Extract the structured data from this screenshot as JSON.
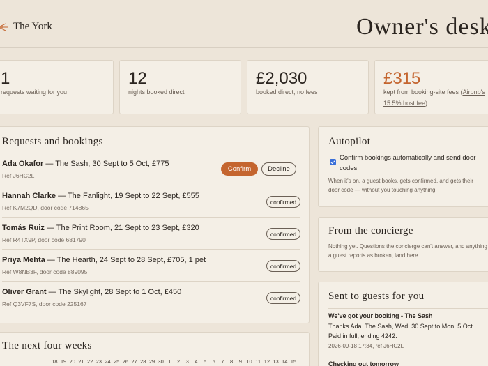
{
  "header": {
    "brand": "The York",
    "title": "Owner's desk"
  },
  "stats": [
    {
      "value": "1",
      "label": "requests waiting for you"
    },
    {
      "value": "12",
      "label": "nights booked direct"
    },
    {
      "value": "£2,030",
      "label": "booked direct, no fees"
    },
    {
      "value": "£315",
      "label_prefix": "kept from booking-site fees (",
      "label_link": "Airbnb's 15.5% host fee",
      "label_suffix": ")"
    }
  ],
  "bookings": {
    "title": "Requests and bookings",
    "confirm_label": "Confirm",
    "decline_label": "Decline",
    "rows": [
      {
        "guest": "Ada Okafor",
        "details": " — The Sash, 30 Sept to 5 Oct, £775",
        "ref": "Ref J6HC2L",
        "status": ""
      },
      {
        "guest": "Hannah Clarke",
        "details": " — The Fanlight, 19 Sept to 22 Sept, £555",
        "ref": "Ref K7M2QD, door code 714865",
        "status": "confirmed"
      },
      {
        "guest": "Tomás Ruiz",
        "details": " — The Print Room, 21 Sept to 23 Sept, £320",
        "ref": "Ref R4TX9P, door code 681790",
        "status": "confirmed"
      },
      {
        "guest": "Priya Mehta",
        "details": " — The Hearth, 24 Sept to 28 Sept, £705, 1 pet",
        "ref": "Ref W8NB3F, door code 889095",
        "status": "confirmed"
      },
      {
        "guest": "Oliver Grant",
        "details": " — The Skylight, 28 Sept to 1 Oct, £450",
        "ref": "Ref Q3VF7S, door code 225167",
        "status": "confirmed"
      }
    ]
  },
  "autopilot": {
    "title": "Autopilot",
    "checkbox_label": "Confirm bookings automatically and send door codes",
    "description": "When it's on, a guest books, gets confirmed, and gets their door code — without you touching anything."
  },
  "concierge": {
    "title": "From the concierge",
    "description": "Nothing yet. Questions the concierge can't answer, and anything a guest reports as broken, land here."
  },
  "sent": {
    "title": "Sent to guests for you",
    "messages": [
      {
        "subject": "We've got your booking - The Sash",
        "body": "Thanks Ada. The Sash, Wed, 30 Sept to Mon, 5 Oct. Paid in full, ending 4242.",
        "meta": "2026-09-18 17:34, ref J6HC2L"
      },
      {
        "subject": "Checking out tomorrow",
        "body": "",
        "meta": ""
      }
    ]
  },
  "calendar": {
    "title": "The next four weeks",
    "days": [
      "18",
      "19",
      "20",
      "21",
      "22",
      "23",
      "24",
      "25",
      "26",
      "27",
      "28",
      "29",
      "30",
      "1",
      "2",
      "3",
      "4",
      "5",
      "6",
      "7",
      "8",
      "9",
      "10",
      "11",
      "12",
      "13",
      "14",
      "15"
    ]
  },
  "colors": {
    "accent": "#c4652f",
    "background": "#ede5d9",
    "card": "#f4efe6"
  }
}
